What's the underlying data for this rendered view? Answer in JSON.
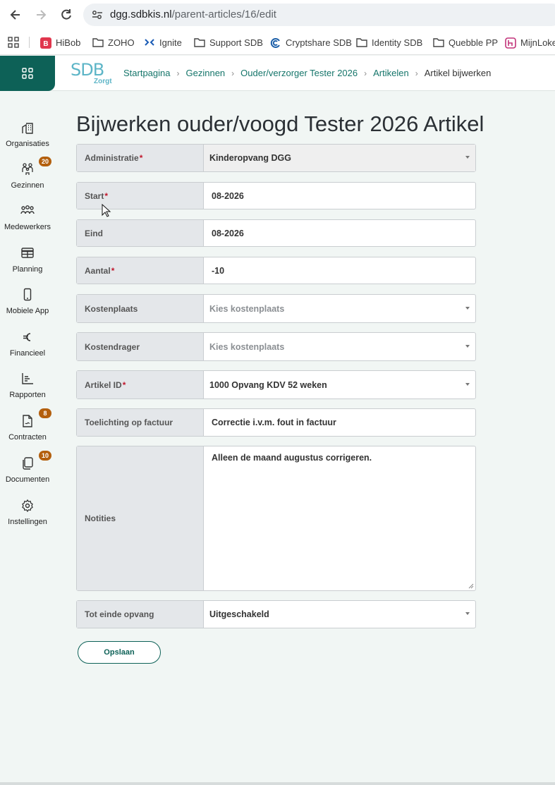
{
  "browser": {
    "url_host": "dgg.sdbkis.nl",
    "url_path": "/parent-articles/16/edit"
  },
  "bookmarks": [
    {
      "label": "HiBob",
      "icon": "hibob-icon"
    },
    {
      "label": "ZOHO",
      "icon": "folder-icon"
    },
    {
      "label": "Ignite",
      "icon": "ignite-icon"
    },
    {
      "label": "Support SDB",
      "icon": "folder-icon"
    },
    {
      "label": "Cryptshare SDB",
      "icon": "cryptshare-icon"
    },
    {
      "label": "Identity SDB",
      "icon": "folder-icon"
    },
    {
      "label": "Quebble PP",
      "icon": "folder-icon"
    },
    {
      "label": "MijnLoke",
      "icon": "mijnloket-icon"
    }
  ],
  "header": {
    "logo_text": "SDB",
    "logo_sub": "Zorgt",
    "breadcrumbs": [
      "Startpagina",
      "Gezinnen",
      "Ouder/verzorger Tester 2026",
      "Artikelen"
    ],
    "breadcrumb_current": "Artikel bijwerken"
  },
  "sidebar": {
    "items": [
      {
        "label": "Organisaties",
        "icon": "building-icon",
        "badge": ""
      },
      {
        "label": "Gezinnen",
        "icon": "family-icon",
        "badge": "20"
      },
      {
        "label": "Medewerkers",
        "icon": "staff-icon",
        "badge": ""
      },
      {
        "label": "Planning",
        "icon": "calendar-table-icon",
        "badge": ""
      },
      {
        "label": "Mobiele App",
        "icon": "phone-icon",
        "badge": ""
      },
      {
        "label": "Financieel",
        "icon": "euro-icon",
        "badge": ""
      },
      {
        "label": "Rapporten",
        "icon": "chart-icon",
        "badge": ""
      },
      {
        "label": "Contracten",
        "icon": "contract-icon",
        "badge": "8"
      },
      {
        "label": "Documenten",
        "icon": "documents-icon",
        "badge": "10"
      },
      {
        "label": "Instellingen",
        "icon": "gear-icon",
        "badge": ""
      }
    ]
  },
  "main": {
    "title": "Bijwerken ouder/voogd Tester 2026 Artikel",
    "fields": {
      "administratie": {
        "label": "Administratie",
        "required": "*",
        "value": "Kinderopvang DGG"
      },
      "start": {
        "label": "Start",
        "required": "*",
        "value": "08-2026"
      },
      "eind": {
        "label": "Eind",
        "value": "08-2026"
      },
      "aantal": {
        "label": "Aantal",
        "required": "*",
        "value": "-10"
      },
      "kostenplaats": {
        "label": "Kostenplaats",
        "placeholder": "Kies kostenplaats"
      },
      "kostendrager": {
        "label": "Kostendrager",
        "placeholder": "Kies kostenplaats"
      },
      "artikel_id": {
        "label": "Artikel ID",
        "required": "*",
        "value": "1000 Opvang KDV 52 weken"
      },
      "toelichting": {
        "label": "Toelichting op factuur",
        "value": "Correctie i.v.m. fout in factuur"
      },
      "notities": {
        "label": "Notities",
        "value": "Alleen de maand augustus corrigeren."
      },
      "tot_einde": {
        "label": "Tot einde opvang",
        "value": "Uitgeschakeld"
      }
    },
    "save_label": "Opslaan"
  }
}
